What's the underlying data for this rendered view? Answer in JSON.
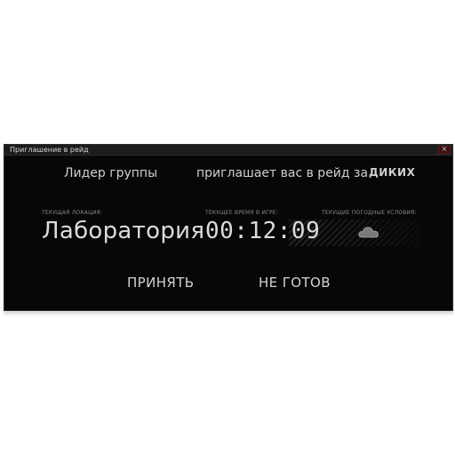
{
  "dialog": {
    "title": "Приглашение в рейд",
    "close_label": "×"
  },
  "invite": {
    "leader": "Лидер группы",
    "text": "приглашает вас в рейд за",
    "target": "ДИКИХ"
  },
  "info": {
    "location_label": "ТЕКУЩАЯ ЛОКАЦИЯ:",
    "location_value": "Лаборатория",
    "time_label": "ТЕКУЩЕЕ ВРЕМЯ В ИГРЕ:",
    "time_value": "00:12:09",
    "weather_label": "ТЕКУЩИЕ ПОГОДНЫЕ УСЛОВИЯ:",
    "weather_icon": "cloud-icon"
  },
  "actions": {
    "accept_label": "ПРИНЯТЬ",
    "not_ready_label": "НЕ ГОТОВ"
  },
  "colors": {
    "dialog_bg": "#070707",
    "titlebar_bg": "#1c1c1c",
    "text": "#cfcfcf",
    "close_bg": "#3a1212"
  }
}
